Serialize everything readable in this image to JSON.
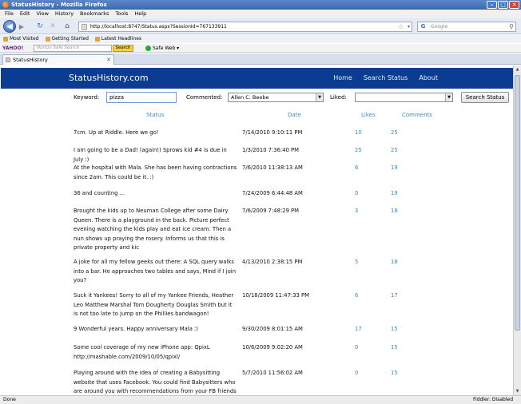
{
  "window": {
    "title": "StatusHistory - Mozilla Firefox"
  },
  "menu": [
    "File",
    "Edit",
    "View",
    "History",
    "Bookmarks",
    "Tools",
    "Help"
  ],
  "nav": {
    "url": "http://localhost:8747/Status.aspx?SessionId=767133911",
    "search_placeholder": "Google"
  },
  "bookmarks": [
    "Most Visited",
    "Getting Started",
    "Latest Headlines"
  ],
  "extbar": {
    "brand": "YAHOO!",
    "search_placeholder": "Norton Safe Search",
    "search_button": "Search",
    "safe_web": "Safe Web ▾"
  },
  "tab": {
    "label": "StatusHistory"
  },
  "site": {
    "brand": "StatusHistory.com",
    "nav": [
      "Home",
      "Search Status",
      "About"
    ]
  },
  "filters": {
    "keyword_label": "Keyword:",
    "keyword_value": "pizza",
    "commented_label": "Commented:",
    "commented_value": "Allen C. Beebe",
    "liked_label": "Liked:",
    "liked_value": "",
    "search_button": "Search Status"
  },
  "table": {
    "headers": {
      "status": "Status",
      "date": "Date",
      "likes": "Likes",
      "comments": "Comments"
    },
    "rows": [
      {
        "status": "7cm. Up at Riddle. Here we go!",
        "date": "7/14/2010 9:10:11 PM",
        "likes": "10",
        "comments": "25"
      },
      {
        "status": "I am going to be a Dad! (again!) Sprows kid #4 is due in July :)",
        "date": "1/3/2010 7:36:40 PM",
        "likes": "25",
        "comments": "25"
      },
      {
        "status": "At the hospital with Mala. She has been having contractions since 2am. This could be it. :)",
        "date": "7/6/2010 11:38:13 AM",
        "likes": "6",
        "comments": "19"
      },
      {
        "status": "36 and counting ...",
        "date": "7/24/2009 6:44:48 AM",
        "likes": "0",
        "comments": "19"
      },
      {
        "status": "Brought the kids up to Neuman College after some Dairy Queen. There is a playground in the back. Picture perfect evening watching the kids play and eat ice cream. Then a nun shows up praying the rosery. Informs us that this is private property and kic",
        "date": "7/6/2009 7:48:29 PM",
        "likes": "3",
        "comments": "18"
      },
      {
        "status": "A joke for all my fellow geeks out there: A SQL query walks into a bar. He approaches two tables and says, Mind if I join you?",
        "date": "4/13/2010 2:38:15 PM",
        "likes": "5",
        "comments": "18"
      },
      {
        "status": "Suck it Yankees! Sorry to all of my Yankee Friends, Heather Leo Matthew Marshal Tom Dougherty Douglas Smith but it is not too late to jump on the Phillies bandwagon!",
        "date": "10/18/2009 11:47:33 PM",
        "likes": "6",
        "comments": "17"
      },
      {
        "status": "9 Wonderful years. Happy anniversary Mala :)",
        "date": "9/30/2009 8:01:15 AM",
        "likes": "17",
        "comments": "15"
      },
      {
        "status": "Some cool coverage of my new iPhone app: QpixL http://mashable.com/2009/10/05/qpixl/",
        "date": "10/6/2009 9:02:20 AM",
        "likes": "0",
        "comments": "15"
      },
      {
        "status": "Playing around with the idea of creating a Babysitting website that uses Facebook. You could find Babysitters who are around you with recommendations from your FB friends and a",
        "date": "5/7/2010 11:56:02 AM",
        "likes": "0",
        "comments": "15"
      }
    ]
  },
  "statusbar": {
    "left": "Done",
    "right": "Fiddler: Disabled"
  }
}
